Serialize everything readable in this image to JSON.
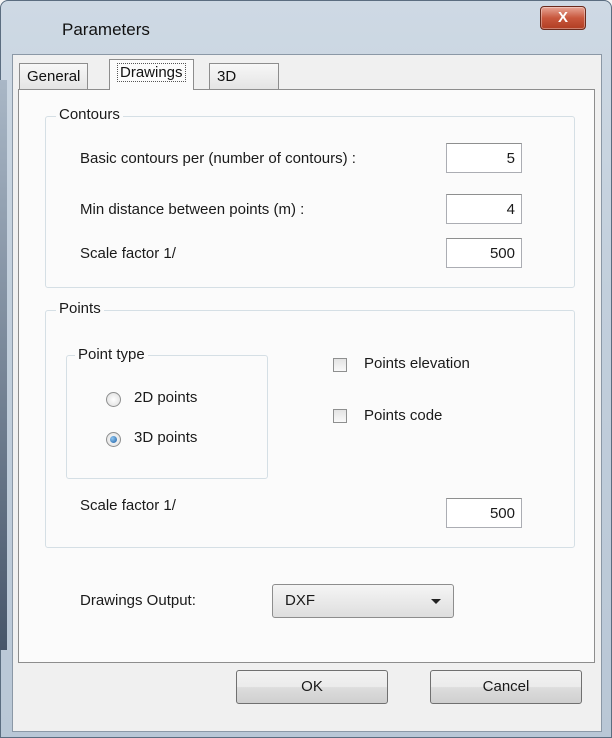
{
  "window": {
    "title": "Parameters",
    "close_label": "X"
  },
  "tabs": [
    {
      "label": "General",
      "active": false
    },
    {
      "label": "Drawings",
      "active": true
    },
    {
      "label": "3D",
      "active": false
    }
  ],
  "contours": {
    "caption": "Contours",
    "basic_label": "Basic contours per (number of contours) :",
    "basic_value": "5",
    "min_distance_label": "Min distance between points (m) :",
    "min_distance_value": "4",
    "scale_label": "Scale factor 1/",
    "scale_value": "500"
  },
  "points": {
    "caption": "Points",
    "point_type": {
      "caption": "Point type",
      "options": [
        {
          "label": "2D points",
          "selected": false
        },
        {
          "label": "3D points",
          "selected": true
        }
      ]
    },
    "elevation": {
      "label": "Points elevation",
      "checked": false
    },
    "code": {
      "label": "Points code",
      "checked": false
    },
    "scale_label": "Scale factor 1/",
    "scale_value": "500"
  },
  "output": {
    "label": "Drawings Output:",
    "selected": "DXF"
  },
  "buttons": {
    "ok": "OK",
    "cancel": "Cancel"
  },
  "icons": {
    "close": "close-icon",
    "dropdown": "chevron-down-icon"
  },
  "colors": {
    "close_button": "#c8573d",
    "radio_selected": "#1e5fa5"
  }
}
